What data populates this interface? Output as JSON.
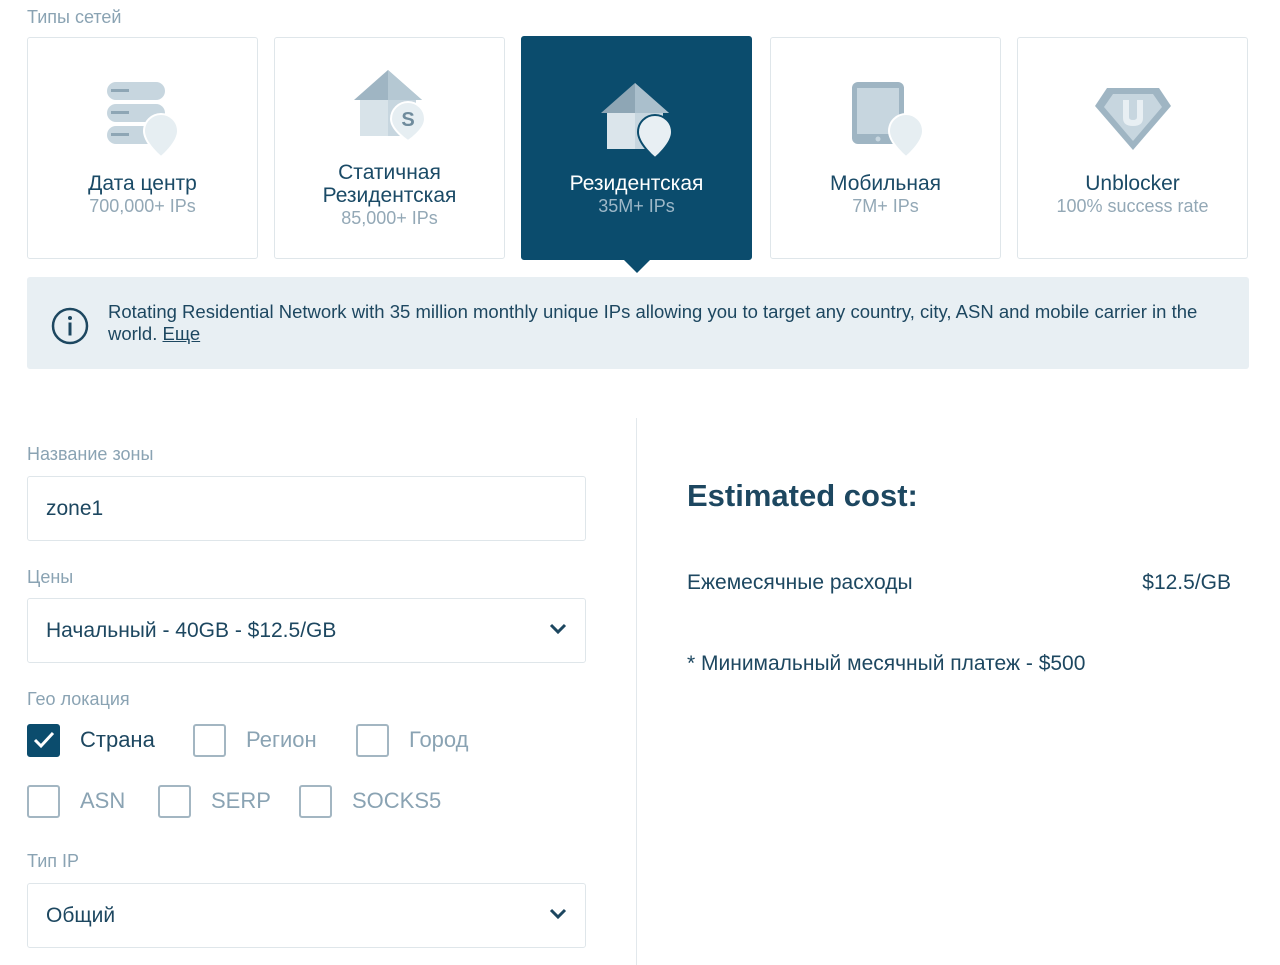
{
  "network_types": {
    "label": "Типы сетей",
    "cards": [
      {
        "title_lines": [
          "Дата центр"
        ],
        "subtitle": "700,000+ IPs",
        "icon": "datacenter-icon",
        "active": false
      },
      {
        "title_lines": [
          "Статичная",
          "Резидентская"
        ],
        "subtitle": "85,000+ IPs",
        "icon": "static-residential-icon",
        "active": false
      },
      {
        "title_lines": [
          "Резидентская"
        ],
        "subtitle": "35M+ IPs",
        "icon": "residential-icon",
        "active": true
      },
      {
        "title_lines": [
          "Мобильная"
        ],
        "subtitle": "7M+ IPs",
        "icon": "mobile-icon",
        "active": false
      },
      {
        "title_lines": [
          "Unblocker"
        ],
        "subtitle": "100% success rate",
        "icon": "unblocker-icon",
        "active": false
      }
    ]
  },
  "info": {
    "text": "Rotating Residential Network with 35 million monthly unique IPs allowing you to target any country, city, ASN and mobile carrier in the world.",
    "more_link": "Еще"
  },
  "form": {
    "zone_name": {
      "label": "Название зоны",
      "value": "zone1"
    },
    "pricing": {
      "label": "Цены",
      "selected": "Начальный - 40GB - $12.5/GB"
    },
    "geo": {
      "label": "Гео локация",
      "options": [
        {
          "label": "Страна",
          "checked": true
        },
        {
          "label": "Регион",
          "checked": false
        },
        {
          "label": "Город",
          "checked": false
        },
        {
          "label": "ASN",
          "checked": false
        },
        {
          "label": "SERP",
          "checked": false
        },
        {
          "label": "SOCKS5",
          "checked": false
        }
      ]
    },
    "ip_type": {
      "label": "Тип IP",
      "selected": "Общий"
    }
  },
  "estimate": {
    "title": "Estimated cost:",
    "monthly_label": "Ежемесячные расходы",
    "monthly_value": "$12.5/GB",
    "note": "* Минимальный месячный платеж - $500"
  },
  "colors": {
    "accent": "#0b4c6d",
    "text": "#1d4760",
    "muted": "#8aa3b3",
    "icon_light": "#c7d6df",
    "icon_mid": "#9fb5c3"
  }
}
